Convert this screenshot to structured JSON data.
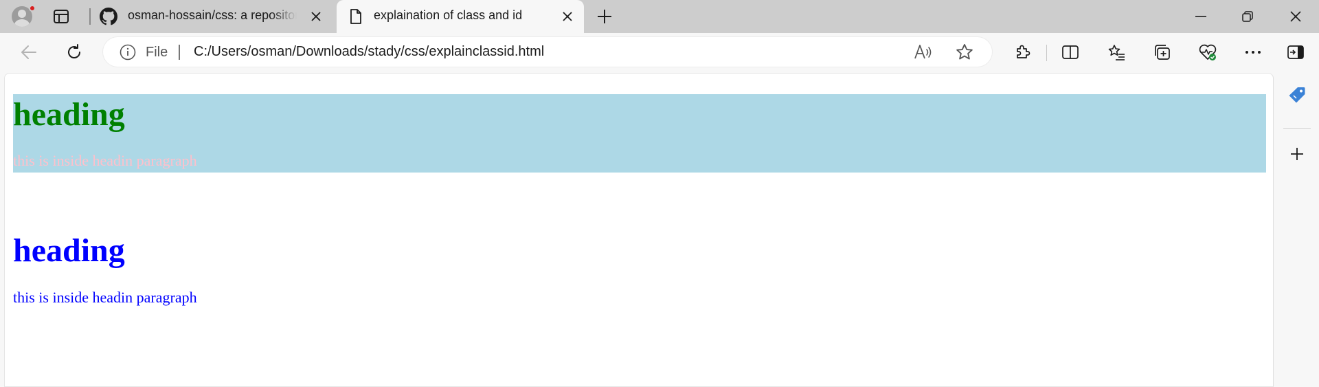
{
  "browser": {
    "tabs": [
      {
        "title": "osman-hossain/css: a repository for css",
        "active": false
      },
      {
        "title": "explaination of class and id",
        "active": true
      }
    ],
    "address": {
      "scheme_label": "File",
      "url": "C:/Users/osman/Downloads/stady/css/explainclassid.html"
    }
  },
  "page": {
    "section1": {
      "heading": "heading",
      "paragraph": "this is inside headin paragraph",
      "background": "#add8e6",
      "heading_color": "#008000",
      "paragraph_color": "#ffc0cb"
    },
    "section2": {
      "heading": "heading",
      "paragraph": "this is inside headin paragraph",
      "heading_color": "#0000ff",
      "paragraph_color": "#0000ff"
    }
  },
  "icons": {
    "profile": "profile-avatar-icon",
    "tab_actions": "tab-actions-icon",
    "github": "github-icon",
    "page": "page-icon",
    "close": "close-icon",
    "new_tab": "plus-icon",
    "minimize": "minimize-icon",
    "restore": "restore-icon",
    "window_close": "close-icon",
    "back": "back-arrow-icon",
    "refresh": "refresh-icon",
    "info": "info-icon",
    "read_aloud": "read-aloud-icon",
    "favorite": "star-icon",
    "extensions": "puzzle-icon",
    "split_screen": "split-screen-icon",
    "favorites": "favorites-icon",
    "collections": "collections-icon",
    "browser_essentials": "heart-pulse-icon",
    "more": "ellipsis-icon",
    "sidebar_toggle": "sidebar-toggle-icon",
    "shopping": "tag-icon",
    "add_sidebar": "plus-icon"
  }
}
